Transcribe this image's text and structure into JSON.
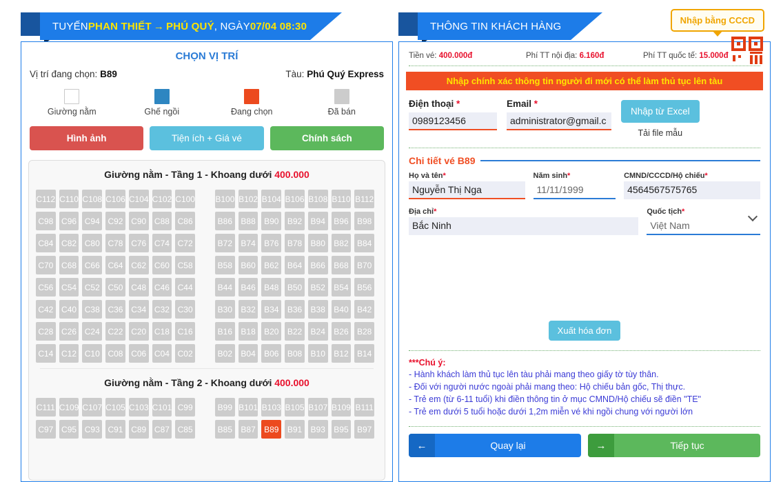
{
  "left": {
    "ribbon": {
      "prefix": "TUYẾN ",
      "from": "PHAN THIẾT",
      "arrow": "→",
      "to": "PHÚ QUÝ",
      "mid": ", NGÀY ",
      "date": "07/04 08:30"
    },
    "title": "CHỌN VỊ TRÍ",
    "current_position_label": "Vị trí đang chọn:",
    "current_position_value": "B89",
    "train_label": "Tàu:",
    "train_value": "Phú Quý Express",
    "legend": [
      {
        "name": "Giường nằm",
        "color": "#ffffff",
        "key": "bed"
      },
      {
        "name": "Ghế ngồi",
        "color": "#2e86c1",
        "key": "seat"
      },
      {
        "name": "Đang chọn",
        "color": "#ec4a1e",
        "key": "sel"
      },
      {
        "name": "Đã bán",
        "color": "#cccccc",
        "key": "sold"
      }
    ],
    "buttons": {
      "images": "Hình ảnh",
      "utilities": "Tiện ích + Giá vé",
      "policy": "Chính sách"
    },
    "decks": [
      {
        "title_prefix": "Giường nằm - Tầng 1 - Khoang dưới ",
        "price": "400.000",
        "rows": [
          {
            "left": [
              "C112",
              "C110",
              "C108",
              "C106",
              "C104",
              "C102",
              "C100"
            ],
            "right": [
              "B100",
              "B102",
              "B104",
              "B106",
              "B108",
              "B110",
              "B112"
            ]
          },
          {
            "left": [
              "C98",
              "C96",
              "C94",
              "C92",
              "C90",
              "C88",
              "C86"
            ],
            "right": [
              "B86",
              "B88",
              "B90",
              "B92",
              "B94",
              "B96",
              "B98"
            ]
          },
          {
            "left": [
              "C84",
              "C82",
              "C80",
              "C78",
              "C76",
              "C74",
              "C72"
            ],
            "right": [
              "B72",
              "B74",
              "B76",
              "B78",
              "B80",
              "B82",
              "B84"
            ]
          },
          {
            "left": [
              "C70",
              "C68",
              "C66",
              "C64",
              "C62",
              "C60",
              "C58"
            ],
            "right": [
              "B58",
              "B60",
              "B62",
              "B64",
              "B66",
              "B68",
              "B70"
            ]
          },
          {
            "left": [
              "C56",
              "C54",
              "C52",
              "C50",
              "C48",
              "C46",
              "C44"
            ],
            "right": [
              "B44",
              "B46",
              "B48",
              "B50",
              "B52",
              "B54",
              "B56"
            ]
          },
          {
            "left": [
              "C42",
              "C40",
              "C38",
              "C36",
              "C34",
              "C32",
              "C30"
            ],
            "right": [
              "B30",
              "B32",
              "B34",
              "B36",
              "B38",
              "B40",
              "B42"
            ]
          },
          {
            "left": [
              "C28",
              "C26",
              "C24",
              "C22",
              "C20",
              "C18",
              "C16"
            ],
            "right": [
              "B16",
              "B18",
              "B20",
              "B22",
              "B24",
              "B26",
              "B28"
            ]
          },
          {
            "left": [
              "C14",
              "C12",
              "C10",
              "C08",
              "C06",
              "C04",
              "C02"
            ],
            "right": [
              "B02",
              "B04",
              "B06",
              "B08",
              "B10",
              "B12",
              "B14"
            ]
          }
        ]
      },
      {
        "title_prefix": "Giường nằm - Tầng 2 - Khoang dưới ",
        "price": "400.000",
        "rows": [
          {
            "left": [
              "C111",
              "C109",
              "C107",
              "C105",
              "C103",
              "C101",
              "C99"
            ],
            "right": [
              "B99",
              "B101",
              "B103",
              "B105",
              "B107",
              "B109",
              "B111"
            ]
          },
          {
            "left": [
              "C97",
              "C95",
              "C93",
              "C91",
              "C89",
              "C87",
              "C85"
            ],
            "right": [
              "B85",
              "B87",
              "B89",
              "B91",
              "B93",
              "B95",
              "B97"
            ]
          }
        ],
        "selected": [
          "B89"
        ]
      }
    ]
  },
  "right": {
    "ribbon_title": "THÔNG TIN KHÁCH HÀNG",
    "tooltip_cccd": "Nhập bằng CCCD",
    "fees": [
      {
        "label": "Tiền vé: ",
        "value": "400.000đ"
      },
      {
        "label": "Phí TT nội địa: ",
        "value": "6.160đ"
      },
      {
        "label": "Phí TT quốc tế: ",
        "value": "15.000đ"
      }
    ],
    "warning": "Nhập chính xác thông tin người đi mới có thể làm thủ tục lên tàu",
    "contact": {
      "phone_label": "Điện thoại",
      "phone_value": "0989123456",
      "email_label": "Email",
      "email_value": "administrator@gmail.c",
      "excel_button": "Nhập từ Excel",
      "sample_link": "Tải file mẫu",
      "required_mark": "*"
    },
    "detail_section_title": "Chi tiết vé B89",
    "passenger": {
      "name_label": "Họ và tên",
      "name_value": "Nguyễn Thị Nga",
      "birth_label": "Năm sinh",
      "birth_value": "11/11/1999",
      "id_label": "CMND/CCCD/Hộ chiếu",
      "id_value": "4564567575765",
      "address_label": "Địa chỉ",
      "address_value": "Bắc Ninh",
      "nationality_label": "Quốc tịch",
      "nationality_value": "Việt Nam",
      "required_mark": "*"
    },
    "invoice_button": "Xuất hóa đơn",
    "notes_title": "***Chú ý:",
    "notes": [
      "- Hành khách làm thủ tục lên tàu phải mang theo giấy tờ tùy thân.",
      "- Đối với người nước ngoài phải mang theo: Hộ chiếu bản gốc, Thị thực.",
      "- Trẻ em (từ 6-11 tuổi) khi điền thông tin ở mục CMND/Hộ chiếu sẽ điền \"TE\"",
      "- Trẻ em dưới 5 tuổi hoặc dưới 1,2m miễn vé khi ngồi chung với người lớn"
    ],
    "footer": {
      "back_label": "Quay lại",
      "back_icon": "arrow-left-icon",
      "next_label": "Tiếp tục",
      "next_icon": "arrow-right-icon"
    }
  },
  "colors": {
    "brand_blue": "#1d7ce8",
    "accent_orange": "#f04e23",
    "sold_gray": "#cccccc",
    "selected_orange": "#ec4a1e",
    "seat_blue": "#2e86c1",
    "price_red": "#e8112d",
    "yellow": "#ffe400"
  }
}
